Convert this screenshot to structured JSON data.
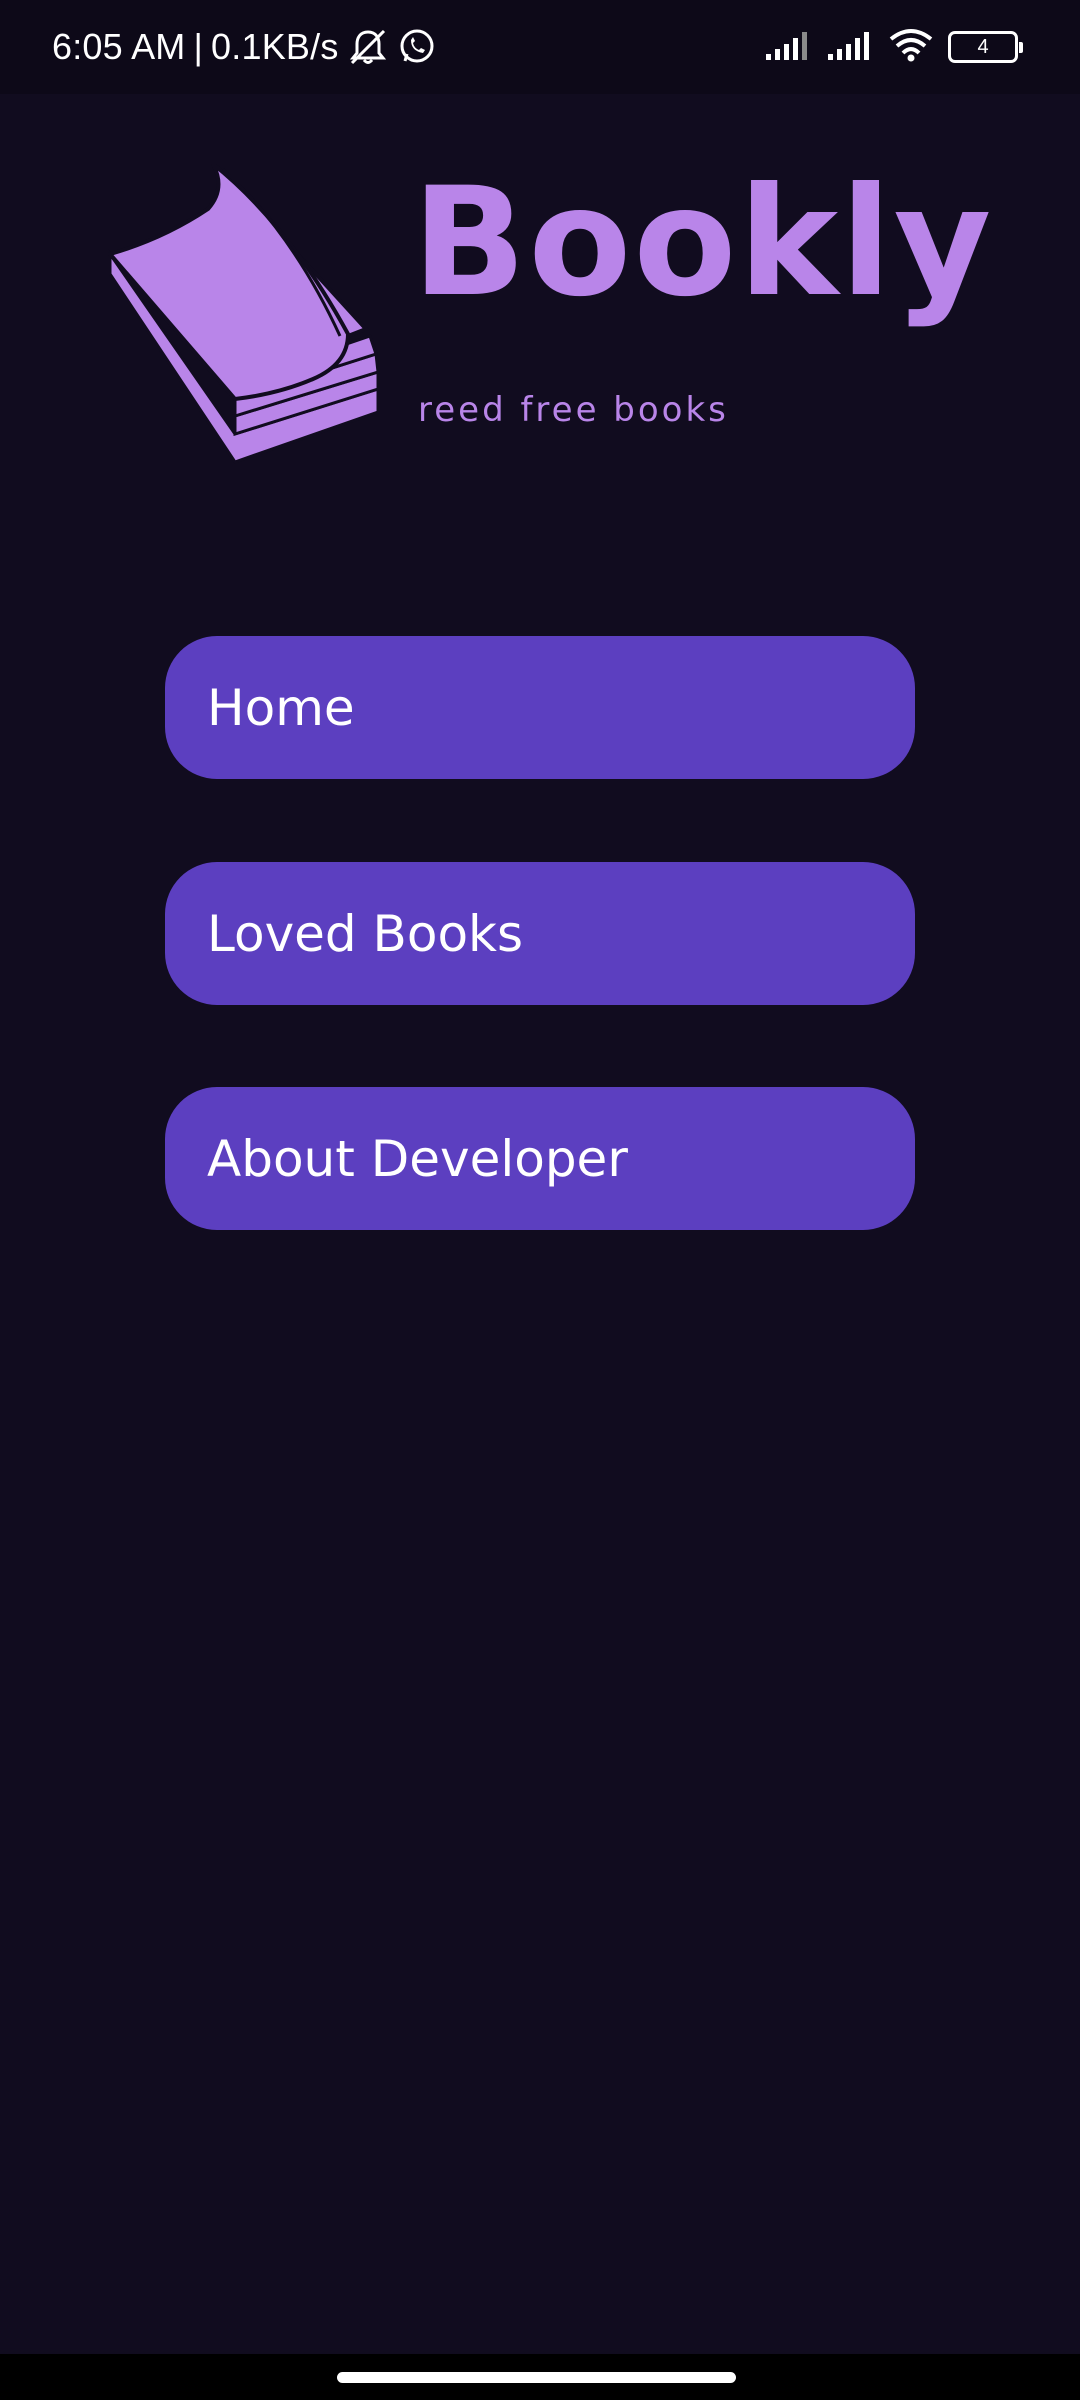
{
  "status_bar": {
    "time": "6:05 AM",
    "separator": "|",
    "network_speed": "0.1KB/s",
    "battery_level": "4",
    "icons": [
      "mute-bell-icon",
      "whatsapp-icon",
      "signal-icon",
      "signal-icon",
      "wifi-icon",
      "battery-icon"
    ]
  },
  "brand": {
    "name": "Bookly",
    "tagline": "reed free books",
    "color": "#b985e9"
  },
  "menu": {
    "items": [
      {
        "label": "Home"
      },
      {
        "label": "Loved Books"
      },
      {
        "label": "About Developer"
      }
    ],
    "button_color": "#5c3fc0"
  },
  "theme": {
    "background": "#110c1f"
  }
}
